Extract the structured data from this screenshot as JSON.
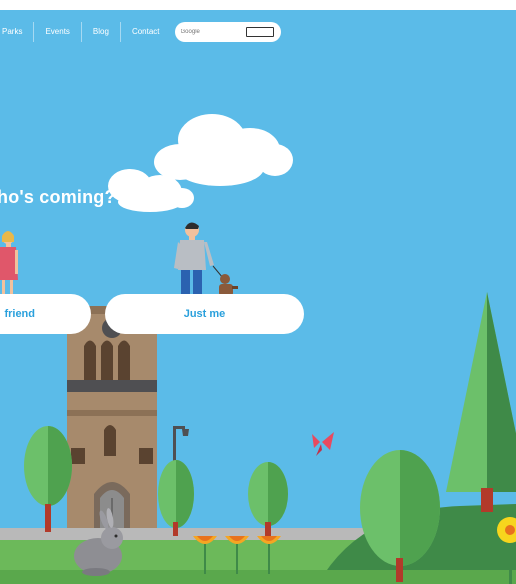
{
  "nav": {
    "items": [
      "Parks",
      "Events",
      "Blog",
      "Contact"
    ],
    "search_placeholder": "Google"
  },
  "question": "ho's coming?",
  "choices": {
    "friend": "friend",
    "just_me": "Just me"
  },
  "colors": {
    "sky": "#5bbbe8",
    "grass": "#6cb95a",
    "tree_dark": "#3f8a48",
    "tree_light": "#6cc06a",
    "tower": "#a78a6c",
    "button_text": "#2aa0dc"
  }
}
